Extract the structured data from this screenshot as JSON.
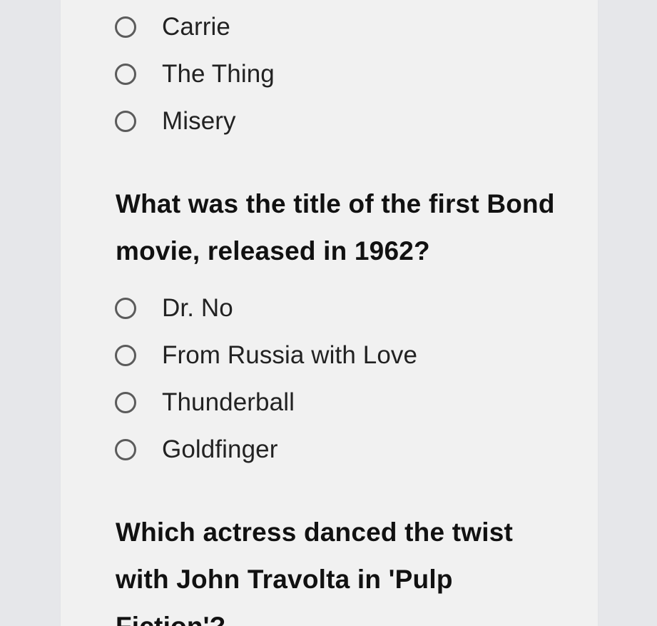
{
  "quiz": {
    "previous_question": {
      "options": [
        "Carrie",
        "The Thing",
        "Misery"
      ]
    },
    "question_bond": {
      "text": "What was the title of the first Bond movie, released in 1962?",
      "options": [
        "Dr. No",
        "From Russia with Love",
        "Thunderball",
        "Goldfinger"
      ]
    },
    "question_pulp": {
      "text": "Which actress danced the twist with John Travolta in 'Pulp Fiction'?"
    }
  },
  "colors": {
    "page_background": "#e8e8ea",
    "card_background": "#f1f1f1",
    "question_text": "#111111",
    "option_text": "#222222",
    "radio_outline": "#5b5b5b"
  },
  "icons": {
    "radio": "radio-unselected-icon"
  }
}
